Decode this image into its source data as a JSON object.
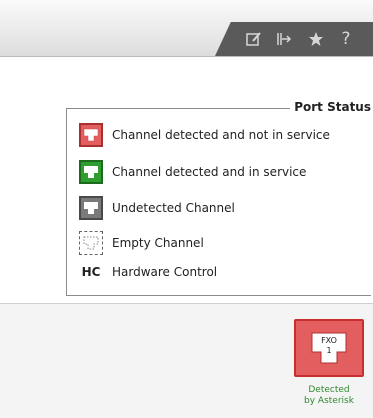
{
  "toolbar": {
    "icons": [
      "edit-icon",
      "pin-icon",
      "star-icon",
      "help-icon"
    ],
    "help_glyph": "?"
  },
  "legend": {
    "title": "Port Status",
    "items": [
      {
        "label": "Channel detected and not in service",
        "state": "red"
      },
      {
        "label": "Channel detected and in service",
        "state": "green"
      },
      {
        "label": "Undetected Channel",
        "state": "gray"
      },
      {
        "label": "Empty Channel",
        "state": "empty"
      },
      {
        "label": "Hardware Control",
        "code": "HC"
      }
    ]
  },
  "port": {
    "type": "FXO",
    "number": "1",
    "status_line1": "Detected",
    "status_line2": "by Asterisk"
  },
  "colors": {
    "red": "#e35e5e",
    "green": "#2f9e2f",
    "gray": "#7a7a7a",
    "status_text": "#2e8b2e"
  }
}
